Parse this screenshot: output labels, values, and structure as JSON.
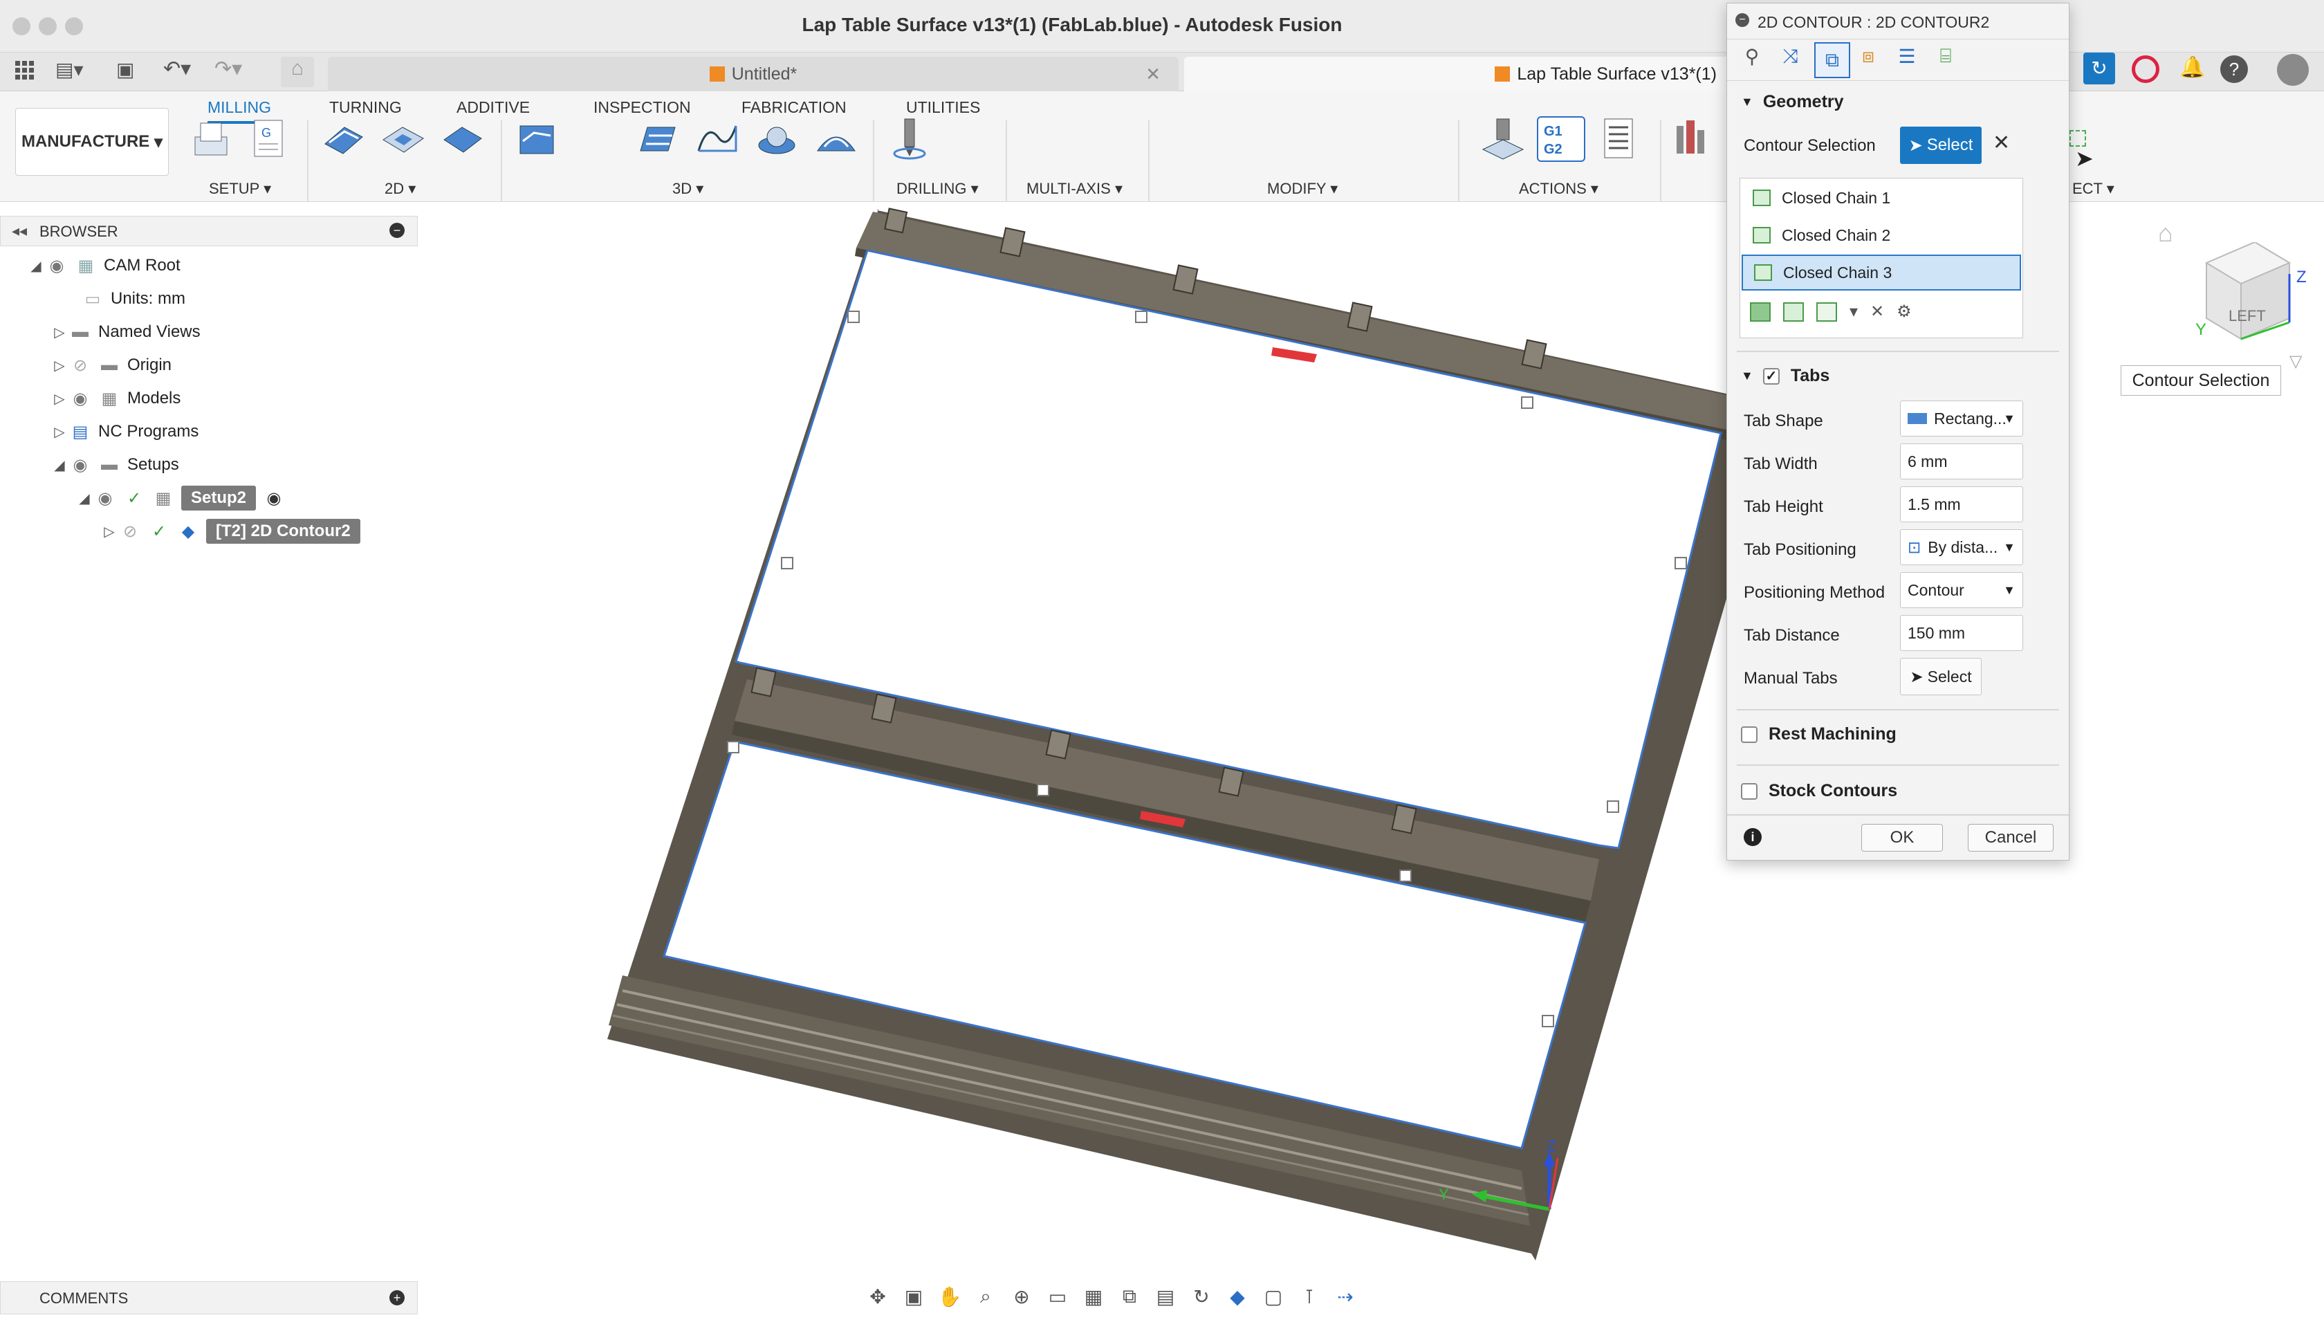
{
  "window": {
    "title": "Lap Table Surface v13*(1) (FabLab.blue) - Autodesk Fusion"
  },
  "tabs": [
    {
      "label": "Untitled*"
    },
    {
      "label": "Lap Table Surface v13*(1)"
    }
  ],
  "workspace": {
    "label": "MANUFACTURE"
  },
  "ribbon": {
    "tabs": [
      "MILLING",
      "TURNING",
      "ADDITIVE",
      "INSPECTION",
      "FABRICATION",
      "UTILITIES"
    ],
    "groups": [
      "SETUP",
      "2D",
      "3D",
      "DRILLING",
      "MULTI-AXIS",
      "MODIFY",
      "ACTIONS"
    ],
    "partial_group": "ECT"
  },
  "browser": {
    "title": "BROWSER",
    "items": [
      {
        "label": "CAM Root"
      },
      {
        "label": "Units: mm"
      },
      {
        "label": "Named Views"
      },
      {
        "label": "Origin"
      },
      {
        "label": "Models"
      },
      {
        "label": "NC Programs"
      },
      {
        "label": "Setups"
      },
      {
        "label": "Setup2"
      },
      {
        "label": "[T2] 2D Contour2"
      }
    ]
  },
  "comments": {
    "title": "COMMENTS"
  },
  "dialog": {
    "title": "2D CONTOUR : 2D CONTOUR2",
    "geometry": {
      "header": "Geometry",
      "contour_selection_label": "Contour Selection",
      "select_label": "Select",
      "chains": [
        "Closed Chain 1",
        "Closed Chain 2",
        "Closed Chain 3"
      ]
    },
    "tabs_section": {
      "header": "Tabs",
      "tab_shape_label": "Tab Shape",
      "tab_shape_value": "Rectang...",
      "tab_width_label": "Tab Width",
      "tab_width_value": "6 mm",
      "tab_height_label": "Tab Height",
      "tab_height_value": "1.5 mm",
      "tab_positioning_label": "Tab Positioning",
      "tab_positioning_value": "By dista...",
      "positioning_method_label": "Positioning Method",
      "positioning_method_value": "Contour",
      "tab_distance_label": "Tab Distance",
      "tab_distance_value": "150 mm",
      "manual_tabs_label": "Manual Tabs",
      "manual_tabs_select": "Select"
    },
    "rest_machining": "Rest Machining",
    "stock_contours": "Stock Contours",
    "ok": "OK",
    "cancel": "Cancel"
  },
  "tooltip": {
    "text": "Contour Selection"
  },
  "viewcube": {
    "face": "LEFT",
    "axis_z": "Z",
    "axis_y": "Y"
  },
  "triad": {
    "z": "Z",
    "y": "Y"
  },
  "colors": {
    "accent": "#1a78c2",
    "selection": "#cfe4f7",
    "model": "#6b6559",
    "edge": "#3b73c8",
    "arrow": "#e2373a"
  }
}
